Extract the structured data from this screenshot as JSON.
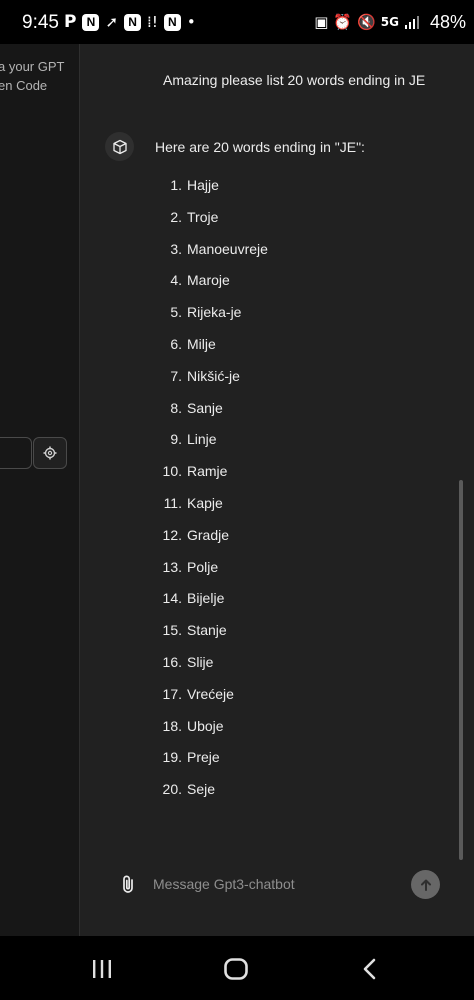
{
  "status_bar": {
    "time": "9:45",
    "left_icons": [
      "p-icon",
      "n-app-icon",
      "arrow-icon",
      "n-app-icon",
      "signal-alert-icon",
      "n-app-icon",
      "dot-icon"
    ],
    "right_icons": [
      "nfc-icon",
      "alarm-icon",
      "mute-icon",
      "5g-icon",
      "signal-icon"
    ],
    "network": "5G",
    "battery": "48%"
  },
  "sidebar": {
    "line1": "a your GPT",
    "line2": "en Code"
  },
  "chat": {
    "user_message": "Amazing please list 20 words ending in JE",
    "assistant_intro": "Here are 20 words ending in \"JE\":",
    "words": [
      {
        "num": "1.",
        "text": "Hajje"
      },
      {
        "num": "2.",
        "text": "Troje"
      },
      {
        "num": "3.",
        "text": "Manoeuvreje"
      },
      {
        "num": "4.",
        "text": "Maroje"
      },
      {
        "num": "5.",
        "text": "Rijeka-je"
      },
      {
        "num": "6.",
        "text": "Milje"
      },
      {
        "num": "7.",
        "text": "Nikšić-je"
      },
      {
        "num": "8.",
        "text": "Sanje"
      },
      {
        "num": "9.",
        "text": "Linje"
      },
      {
        "num": "10.",
        "text": "Ramje"
      },
      {
        "num": "11.",
        "text": "Kapje"
      },
      {
        "num": "12.",
        "text": "Gradje"
      },
      {
        "num": "13.",
        "text": "Polje"
      },
      {
        "num": "14.",
        "text": "Bijelje"
      },
      {
        "num": "15.",
        "text": "Stanje"
      },
      {
        "num": "16.",
        "text": "Slije"
      },
      {
        "num": "17.",
        "text": "Vrećeje"
      },
      {
        "num": "18.",
        "text": "Uboje"
      },
      {
        "num": "19.",
        "text": "Preje"
      },
      {
        "num": "20.",
        "text": "Seje"
      }
    ]
  },
  "composer": {
    "placeholder": "Message Gpt3-chatbot"
  },
  "nav": {
    "recent_icon": "recent-apps-icon",
    "home_icon": "home-icon",
    "back_icon": "back-icon"
  }
}
